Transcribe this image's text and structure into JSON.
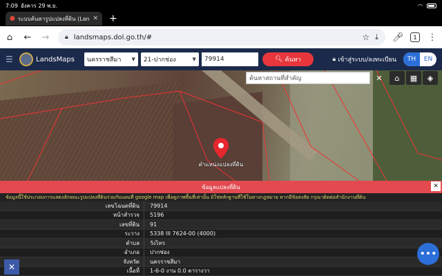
{
  "status": {
    "time": "7:09",
    "date": "อังคาร 29 พ.ย."
  },
  "browser": {
    "tab_title": "ระบบค้นหารูปแปลงที่ดิน (Lan",
    "url": "landsmaps.dol.go.th/#",
    "tab_count": "1"
  },
  "app": {
    "name": "LandsMaps",
    "province": "นครราชสีมา",
    "district": "21-ปากช่อง",
    "parcel_input": "79914",
    "search_label": "ค้นหา",
    "login_label": "เข้าสู่ระบบ/ลงทะเบียน",
    "lang_th": "TH",
    "lang_en": "EN"
  },
  "map": {
    "place_search_placeholder": "ค้นหาสถานที่สำคัญ",
    "marker_label": "ตำแหน่งแปลงที่ดิน"
  },
  "panel": {
    "title": "ข้อมูลแปลงที่ดิน",
    "notice": "ข้อมูลนี้ใช้ประกอบการแสดงลักษณะรูปแปลงที่ดินร่วมกับแผนที่ google map เพื่อดูภาพพื้นที่เท่านั้น มิใช่หลักฐานที่ใช้ในทางกฎหมาย หากมีข้อสงสัย กรุณาติดต่อสำนักงานที่ดิน",
    "rows": [
      {
        "key": "เลขโฉนดที่ดิน",
        "value": "79914"
      },
      {
        "key": "หน้าสำรวจ",
        "value": "5196"
      },
      {
        "key": "เลขที่ดิน",
        "value": "91"
      },
      {
        "key": "ระวาง",
        "value": "5338 III 7624-00 (4000)"
      },
      {
        "key": "ตำบล",
        "value": "วังไทร"
      },
      {
        "key": "อำเภอ",
        "value": "ปากช่อง"
      },
      {
        "key": "จังหวัด",
        "value": "นครราชสีมา"
      },
      {
        "key": "เนื้อที่",
        "value": "1-6-0 งาน 0.0 ตารางวา"
      }
    ]
  }
}
